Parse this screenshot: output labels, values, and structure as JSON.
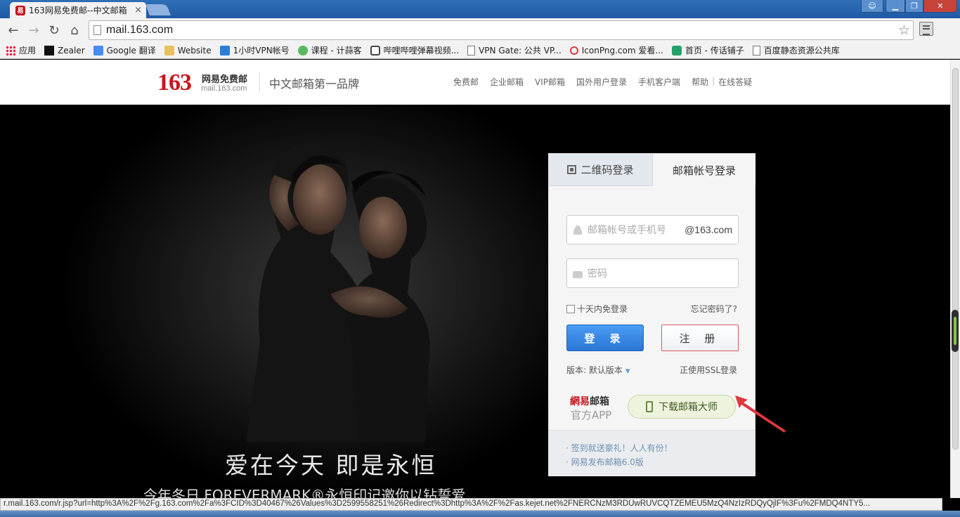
{
  "browser": {
    "tab_title": "163网易免费邮--中文邮箱",
    "tab_close": "×",
    "favicon_text": "易",
    "url": "mail.163.com",
    "bookmarks": [
      {
        "label": "应用",
        "icon": "apps-icon"
      },
      {
        "label": "Zealer",
        "icon": "zealer-icon"
      },
      {
        "label": "Google 翻译",
        "icon": "google-translate-icon"
      },
      {
        "label": "Website",
        "icon": "folder-icon"
      },
      {
        "label": "1小时VPN帐号",
        "icon": "vpn-icon"
      },
      {
        "label": "课程 - 计蒜客",
        "icon": "course-icon"
      },
      {
        "label": "哔哩哔哩弹幕视频...",
        "icon": "bilibili-icon"
      },
      {
        "label": "VPN Gate: 公共 VP...",
        "icon": "document-icon"
      },
      {
        "label": "IconPng.com 爱看...",
        "icon": "search-icon"
      },
      {
        "label": "首页 - 传话铺子",
        "icon": "chat-icon"
      },
      {
        "label": "百度静态资源公共库",
        "icon": "document-icon"
      }
    ],
    "status_url": "r.mail.163.com/r.jsp?url=http%3A%2F%2Fg.163.com%2Fa%3FCID%3D40467%26Values%3D2599558251%26Redirect%3Dhttp%3A%2F%2Fas.kejet.net%2FNERCNzM3RDUwRUVCQTZEMEU5MzQ4NzIzRDQyQjlF%3Fu%2FMDQ4NTY5..."
  },
  "site": {
    "logo_number": "163",
    "logo_cn": "网易免费邮",
    "logo_domain": "mail.163.com",
    "slogan": "中文邮箱第一品牌",
    "nav": [
      "免费邮",
      "企业邮箱",
      "VIP邮箱",
      "国外用户登录",
      "手机客户端",
      "帮助",
      "在线答疑"
    ],
    "nav_separator": "|"
  },
  "hero": {
    "caption": "爱在今天 即是永恒",
    "subcaption": "今年冬日 FOREVERMARK®永恒印记邀你以钻誓爱"
  },
  "login": {
    "tab_qr": "二维码登录",
    "tab_account": "邮箱帐号登录",
    "user_placeholder": "邮箱帐号或手机号",
    "user_suffix": "@163.com",
    "password_placeholder": "密码",
    "remember": "十天内免登录",
    "forgot": "忘记密码了?",
    "login_button": "登 录",
    "register_button": "注 册",
    "version": "版本: 默认版本",
    "version_caret": "▼",
    "ssl": "正使用SSL登录",
    "app_logo_red": "網易",
    "app_logo_dark": "邮箱",
    "app_official": "官方APP",
    "download_button": "下载邮箱大师",
    "promos": [
      "· 签到就送豪礼！人人有份！",
      "· 网易发布邮箱6.0版"
    ]
  },
  "colors": {
    "brand_red": "#c8161e",
    "login_blue": "#2a77d6",
    "annotation_red": "#e0373b"
  }
}
